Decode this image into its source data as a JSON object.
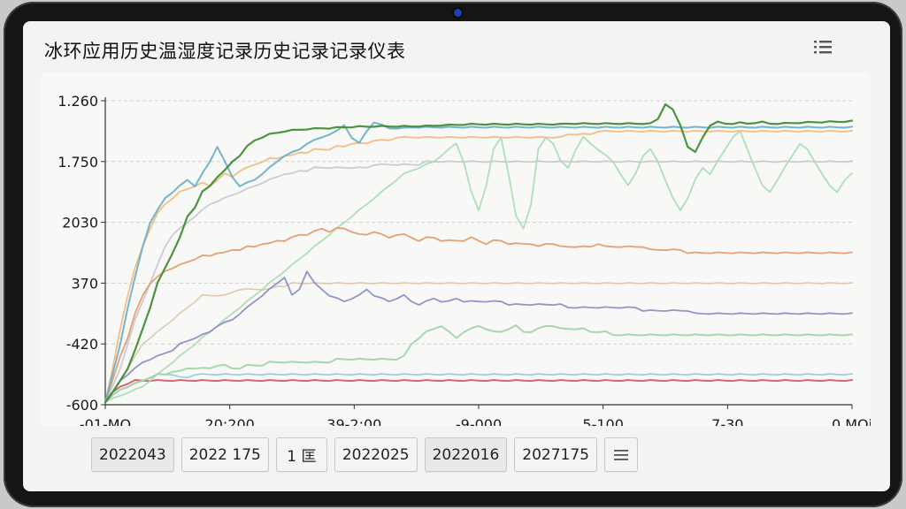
{
  "window": {
    "title": "冰环应用历史温湿度记录历史记录记录仪表"
  },
  "filters": [
    {
      "label": "2022043",
      "active": true
    },
    {
      "label": "2022 175",
      "active": false
    },
    {
      "label": "1 匡",
      "active": false
    },
    {
      "label": "2022025",
      "active": false
    },
    {
      "label": "2022016",
      "active": true
    },
    {
      "label": "2027175",
      "active": false
    }
  ],
  "icons": {
    "header_menu": "list-icon",
    "row_menu": "hamburger-icon"
  },
  "chart_data": {
    "type": "line",
    "y_tick_labels": [
      "1.260",
      "1.750",
      "2030",
      "370",
      "-420",
      "-600"
    ],
    "x_tick_labels": [
      "-01-MO",
      "20:200",
      "39-2:00",
      "-9-000",
      "5-100",
      "7-30",
      "0.MOi"
    ],
    "xlim": [
      0,
      100
    ],
    "ylim": [
      0,
      100
    ],
    "grid": true,
    "series": [
      {
        "color": "#3e8a32",
        "width": 2.2,
        "values": [
          1,
          4,
          8,
          12,
          18,
          25,
          32,
          40,
          45,
          50,
          55,
          62,
          65,
          70,
          72,
          75,
          77,
          80,
          82,
          85,
          87,
          88,
          89,
          89.5,
          90,
          90.3,
          90.5,
          90.7,
          90.8,
          91,
          91,
          91.2,
          91.3,
          91.4,
          91.5,
          91.5,
          91.6,
          91.6,
          91.6,
          91.6,
          91.6,
          91.6,
          91.7,
          91.7,
          91.8,
          92,
          92,
          92.1,
          92.2,
          92.3,
          92.3,
          92.3,
          92.3,
          92.3,
          92.3,
          92.3,
          92.3,
          92.3,
          92.3,
          92.3,
          92.3,
          92.3,
          92.5,
          92.5,
          92.5,
          92.5,
          92.5,
          92.5,
          92.5,
          92.5,
          92.5,
          92.5,
          92.5,
          92.5,
          94,
          99,
          97,
          92,
          85,
          83,
          88,
          92,
          93,
          92.5,
          92.5,
          92.8,
          92.5,
          92.8,
          93,
          92.5,
          92.5,
          92.6,
          92.7,
          92.8,
          92.9,
          93,
          93,
          93.1,
          93.1,
          93.2,
          93.3
        ]
      },
      {
        "color": "#6aaec9",
        "width": 2.0,
        "values": [
          1,
          10,
          20,
          32,
          42,
          52,
          60,
          64,
          68,
          70,
          72,
          74,
          72,
          76,
          80,
          85,
          80,
          75,
          72,
          73,
          74,
          76,
          78,
          80,
          82,
          83,
          84,
          86,
          87,
          88,
          89,
          90,
          92,
          88,
          86,
          90,
          93,
          92,
          91,
          91,
          91,
          91.3,
          91.3,
          91.3,
          91.3,
          91.3,
          91.3,
          91.3,
          91.3,
          91.3,
          91.3,
          91.3,
          91.3,
          91.3,
          91.3,
          91.3,
          91.3,
          91.3,
          91.3,
          91.3,
          91.3,
          91.3,
          91.3,
          91.3,
          91.3,
          91.3,
          91.3,
          91.3,
          91.3,
          91.3,
          91.3,
          91.3,
          91.3,
          91.3,
          91.3,
          91.3,
          91.3,
          91.3,
          91.3,
          91.3,
          91.3,
          91.3,
          91.3,
          91.3,
          91.3,
          91.3,
          91.3,
          91.3,
          91.3,
          91.3,
          91.3,
          91.3,
          91.3,
          91.3,
          91.3,
          91.3,
          91.3,
          91.3,
          91.3,
          91.3,
          91.3
        ]
      },
      {
        "color": "#f0b87a",
        "width": 1.8,
        "values": [
          1,
          12,
          25,
          36,
          45,
          52,
          58,
          63,
          66,
          68,
          70,
          71,
          72,
          73,
          72,
          74,
          76,
          75,
          77,
          78,
          79,
          80,
          81,
          81,
          82,
          82,
          83,
          83,
          84,
          84,
          84,
          85,
          85,
          86,
          86,
          86,
          87,
          87,
          87,
          88,
          88,
          88,
          88,
          88,
          88,
          88,
          88,
          88,
          88,
          88,
          88,
          88,
          88,
          88,
          88,
          88,
          88,
          88,
          88,
          88,
          88,
          88,
          89,
          89,
          89,
          89,
          90,
          90,
          90,
          90,
          90,
          90,
          90,
          90,
          90,
          90,
          90,
          90,
          90,
          90,
          90,
          90,
          90,
          90,
          90,
          90,
          90,
          90,
          90,
          90,
          90,
          90,
          90,
          90,
          90,
          90,
          90,
          90,
          90,
          90,
          90
        ]
      },
      {
        "color": "#e09a6a",
        "width": 1.8,
        "values": [
          1,
          8,
          16,
          22,
          30,
          36,
          40,
          42,
          44,
          45,
          46,
          47,
          48,
          49,
          49,
          50,
          50,
          51,
          51,
          52,
          52,
          53,
          53,
          54,
          54,
          55,
          56,
          56,
          57,
          58,
          57,
          58,
          58,
          57,
          56,
          56,
          57,
          56,
          55,
          56,
          56,
          55,
          54,
          55,
          55,
          54,
          54,
          54,
          54,
          55,
          54,
          53,
          54,
          54,
          53,
          53,
          53,
          53,
          52,
          53,
          53,
          52,
          52,
          52,
          52,
          52,
          53,
          52,
          52,
          52,
          52,
          52,
          52,
          51,
          51,
          51,
          51,
          51,
          50,
          50,
          50,
          50,
          50,
          50,
          50,
          50,
          50,
          50,
          50,
          50,
          50,
          50,
          50,
          50,
          50,
          50,
          50,
          50,
          50,
          50,
          50
        ]
      },
      {
        "color": "#c9c5d4",
        "width": 1.8,
        "values": [
          1,
          6,
          12,
          20,
          28,
          34,
          40,
          46,
          52,
          56,
          58,
          60,
          62,
          64,
          66,
          67,
          68,
          69,
          70,
          71,
          72,
          73,
          74,
          75,
          76,
          76,
          77,
          77,
          78,
          78,
          78,
          78,
          78,
          78,
          78,
          78,
          79,
          79,
          79,
          79,
          79,
          79,
          79,
          80,
          80,
          80,
          80,
          80,
          80,
          80,
          80,
          80,
          80,
          80,
          80,
          80,
          80,
          80,
          80,
          80,
          80,
          80,
          80,
          80,
          80,
          80,
          80,
          80,
          80,
          80,
          80,
          80,
          80,
          80,
          80,
          80,
          80,
          80,
          80,
          80,
          80,
          80,
          80,
          80,
          80,
          80,
          80,
          80,
          80,
          80,
          80,
          80,
          80,
          80,
          80,
          80,
          80,
          80,
          80,
          80,
          80
        ]
      },
      {
        "color": "#8e8ac4",
        "width": 1.8,
        "values": [
          1,
          4,
          8,
          10,
          12,
          14,
          15,
          16,
          17,
          18,
          20,
          21,
          22,
          23,
          24,
          26,
          27,
          28,
          30,
          32,
          34,
          36,
          38,
          40,
          42,
          36,
          38,
          44,
          40,
          38,
          36,
          35,
          34,
          35,
          36,
          38,
          36,
          35,
          34,
          35,
          36,
          34,
          33,
          34,
          35,
          34,
          34,
          35,
          34,
          34,
          34,
          34,
          34,
          34,
          33,
          33,
          33,
          33,
          33,
          33,
          33,
          33,
          32,
          32,
          32,
          32,
          32,
          32,
          32,
          32,
          32,
          32,
          31,
          31,
          31,
          31,
          31,
          31,
          31,
          30,
          30,
          30,
          30,
          30,
          30,
          30,
          30,
          30,
          30,
          30,
          30,
          30,
          30,
          30,
          30,
          30,
          30,
          30,
          30,
          30,
          30
        ]
      },
      {
        "color": "#9fd4a8",
        "width": 2.0,
        "values": [
          1,
          3,
          5,
          6,
          7,
          8,
          9,
          10,
          10,
          11,
          11,
          12,
          12,
          12,
          12,
          13,
          13,
          12,
          12,
          13,
          13,
          13,
          14,
          14,
          14,
          14,
          14,
          14,
          14,
          14,
          14,
          15,
          15,
          15,
          15,
          15,
          15,
          15,
          15,
          15,
          16,
          20,
          22,
          24,
          25,
          26,
          24,
          22,
          24,
          25,
          26,
          25,
          24,
          24,
          25,
          26,
          24,
          24,
          25,
          26,
          26,
          25,
          25,
          25,
          25,
          24,
          24,
          24,
          23,
          23,
          23,
          23,
          23,
          23,
          23,
          23,
          23,
          23,
          23,
          23,
          23,
          23,
          23,
          23,
          23,
          23,
          23,
          23,
          23,
          23,
          23,
          23,
          23,
          23,
          23,
          23,
          23,
          23,
          23,
          23,
          23
        ]
      },
      {
        "color": "#a8dcb4",
        "width": 1.8,
        "values": [
          1,
          2,
          3,
          4,
          5,
          6,
          8,
          10,
          12,
          14,
          16,
          18,
          20,
          22,
          24,
          26,
          28,
          30,
          32,
          34,
          36,
          38,
          40,
          42,
          44,
          46,
          48,
          50,
          52,
          54,
          56,
          58,
          60,
          62,
          64,
          66,
          68,
          70,
          72,
          74,
          76,
          77,
          78,
          79,
          80,
          82,
          84,
          86,
          80,
          70,
          64,
          72,
          84,
          88,
          76,
          62,
          58,
          66,
          84,
          88,
          86,
          80,
          78,
          84,
          88,
          86,
          84,
          82,
          80,
          76,
          72,
          76,
          82,
          84,
          80,
          74,
          68,
          64,
          68,
          74,
          78,
          76,
          80,
          84,
          88,
          90,
          84,
          78,
          72,
          70,
          74,
          78,
          82,
          86,
          84,
          80,
          76,
          72,
          70,
          74,
          76
        ]
      },
      {
        "color": "#cf5a6a",
        "width": 2.0,
        "values": [
          1,
          4,
          6,
          7,
          8,
          8,
          8,
          8,
          8,
          8,
          8,
          8,
          8,
          8,
          8,
          8,
          8,
          8,
          8,
          8,
          8,
          8,
          8,
          8,
          8,
          8,
          8,
          8,
          8,
          8,
          8,
          8,
          8,
          8,
          8,
          8,
          8,
          8,
          8,
          8,
          8,
          8,
          8,
          8,
          8,
          8,
          8,
          8,
          8,
          8,
          8,
          8,
          8,
          8,
          8,
          8,
          8,
          8,
          8,
          8,
          8,
          8,
          8,
          8,
          8,
          8,
          8,
          8,
          8,
          8,
          8,
          8,
          8,
          8,
          8,
          8,
          8,
          8,
          8,
          8,
          8,
          8,
          8,
          8,
          8,
          8,
          8,
          8,
          8,
          8,
          8,
          8,
          8,
          8,
          8,
          8,
          8,
          8,
          8,
          8,
          8
        ]
      },
      {
        "color": "#88c8dc",
        "width": 1.6,
        "values": [
          1,
          3,
          5,
          6,
          7,
          8,
          9,
          10,
          10,
          10,
          9,
          9,
          10,
          10,
          10,
          10,
          10,
          10,
          10,
          10,
          10,
          10,
          10,
          10,
          10,
          10,
          10,
          10,
          10,
          10,
          10,
          10,
          10,
          10,
          10,
          10,
          10,
          10,
          10,
          10,
          10,
          10,
          10,
          10,
          10,
          10,
          10,
          10,
          10,
          10,
          10,
          10,
          10,
          10,
          10,
          10,
          10,
          10,
          10,
          10,
          10,
          10,
          10,
          10,
          10,
          10,
          10,
          10,
          10,
          10,
          10,
          10,
          10,
          10,
          10,
          10,
          10,
          10,
          10,
          10,
          10,
          10,
          10,
          10,
          10,
          10,
          10,
          10,
          10,
          10,
          10,
          10,
          10,
          10,
          10,
          10,
          10,
          10,
          10,
          10,
          10
        ]
      },
      {
        "color": "#d9c7a8",
        "width": 1.6,
        "values": [
          1,
          4,
          8,
          12,
          16,
          20,
          22,
          24,
          26,
          28,
          30,
          32,
          34,
          36,
          36,
          36,
          36,
          37,
          38,
          38,
          38,
          38,
          38,
          39,
          39,
          40,
          40,
          40,
          40,
          40,
          40,
          40,
          40,
          40,
          40,
          40,
          40,
          40,
          40,
          40,
          40,
          40,
          40,
          40,
          40,
          40,
          40,
          40,
          40,
          40,
          40,
          40,
          40,
          40,
          40,
          40,
          40,
          40,
          40,
          40,
          40,
          40,
          40,
          40,
          40,
          40,
          40,
          40,
          40,
          40,
          40,
          40,
          40,
          40,
          40,
          40,
          40,
          40,
          40,
          40,
          40,
          40,
          40,
          40,
          40,
          40,
          40,
          40,
          40,
          40,
          40,
          40,
          40,
          40,
          40,
          40,
          40,
          40,
          40,
          40,
          40
        ]
      }
    ]
  }
}
